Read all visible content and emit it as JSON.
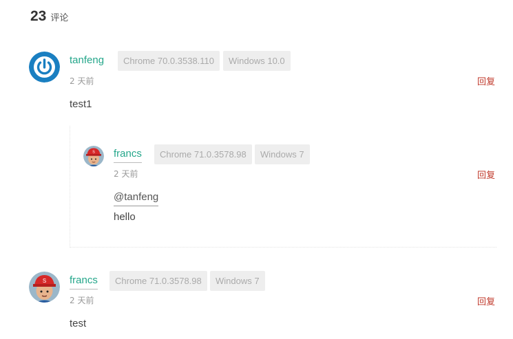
{
  "header": {
    "count": "23",
    "label": "评论"
  },
  "comments": [
    {
      "author": "tanfeng",
      "badges": [
        "Chrome 70.0.3538.110",
        "Windows 10.0"
      ],
      "time": "2 天前",
      "reply_label": "回复",
      "text": "test1",
      "avatar_icon": "power-icon",
      "avatar_color": "#1a7fc1"
    },
    {
      "author": "francs",
      "badges": [
        "Chrome 71.0.3578.98",
        "Windows 7"
      ],
      "time": "2 天前",
      "reply_label": "回复",
      "mention": "@tanfeng",
      "text": "hello",
      "avatar_icon": "cartoon-boy-icon",
      "nested": true
    },
    {
      "author": "francs",
      "badges": [
        "Chrome 71.0.3578.98",
        "Windows 7"
      ],
      "time": "2 天前",
      "reply_label": "回复",
      "text": "test",
      "avatar_icon": "cartoon-boy-icon"
    }
  ],
  "colors": {
    "author": "#24a68a",
    "reply": "#c0392b",
    "badge_bg": "#eeeeee",
    "badge_text": "#aaaaaa"
  }
}
